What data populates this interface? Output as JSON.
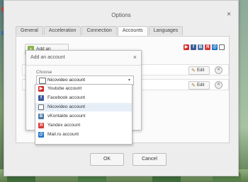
{
  "window": {
    "title": "Options",
    "close_symbol": "×"
  },
  "tabs": [
    {
      "label": "General"
    },
    {
      "label": "Acceleration"
    },
    {
      "label": "Connection"
    },
    {
      "label": "Accounts"
    },
    {
      "label": "Languages"
    }
  ],
  "active_tab": "Accounts",
  "accounts_panel": {
    "add_account_label": "Add an account",
    "edit_label": "Edit"
  },
  "dialog": {
    "title": "Add an account",
    "close_symbol": "×",
    "choose_label": "Choose",
    "selected_value": "Nicovideo account"
  },
  "dropdown": {
    "options": [
      {
        "label": "Youtube account",
        "icon": "youtube-icon",
        "color": "#d52b2b",
        "glyph": "▶"
      },
      {
        "label": "Facebook account",
        "icon": "facebook-icon",
        "color": "#3b5998",
        "glyph": "f"
      },
      {
        "label": "Nicovideo account",
        "icon": "nicovideo-icon",
        "color": "#666666",
        "glyph": "▭"
      },
      {
        "label": "vKontakte account",
        "icon": "vkontakte-icon",
        "color": "#4c75a3",
        "glyph": "B"
      },
      {
        "label": "Yandex account",
        "icon": "yandex-icon",
        "color": "#d43b3b",
        "glyph": "Я"
      },
      {
        "label": "Mail.ru account",
        "icon": "mailru-icon",
        "color": "#1b6fc6",
        "glyph": "@"
      }
    ],
    "selected_index": 2
  },
  "footer": {
    "ok_label": "OK",
    "cancel_label": "Cancel"
  }
}
